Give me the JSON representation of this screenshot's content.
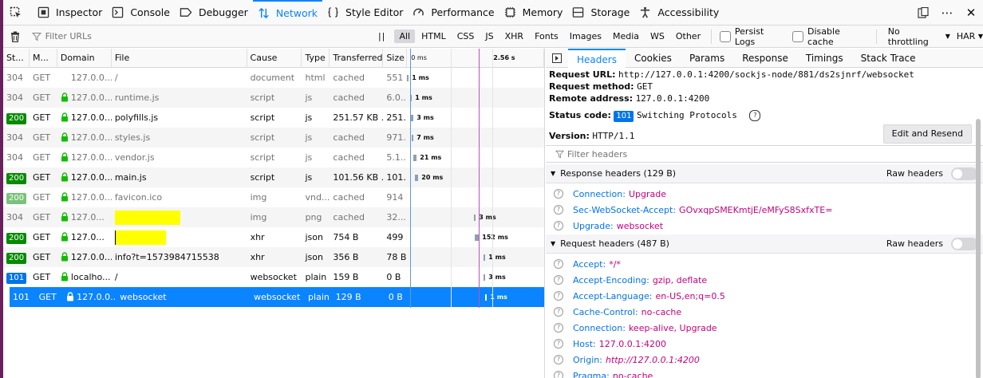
{
  "toolbar": {
    "tabs": [
      {
        "label": "Inspector",
        "icon": "inspector-icon"
      },
      {
        "label": "Console",
        "icon": "console-icon"
      },
      {
        "label": "Debugger",
        "icon": "debugger-icon"
      },
      {
        "label": "Network",
        "icon": "network-icon",
        "selected": true
      },
      {
        "label": "Style Editor",
        "icon": "style-editor-icon"
      },
      {
        "label": "Performance",
        "icon": "performance-icon"
      },
      {
        "label": "Memory",
        "icon": "memory-icon"
      },
      {
        "label": "Storage",
        "icon": "storage-icon"
      },
      {
        "label": "Accessibility",
        "icon": "accessibility-icon"
      }
    ],
    "more": "⋯",
    "close": "✕"
  },
  "filterbar": {
    "placeholder": "Filter URLs",
    "types": [
      "All",
      "HTML",
      "CSS",
      "JS",
      "XHR",
      "Fonts",
      "Images",
      "Media",
      "WS",
      "Other"
    ],
    "persist_logs": "Persist Logs",
    "disable_cache": "Disable cache",
    "throttling": "No throttling",
    "har": "HAR"
  },
  "columns": [
    "St...",
    "M...",
    "Domain",
    "File",
    "Cause",
    "Type",
    "Transferred",
    "Size"
  ],
  "waterfall_ticks": [
    "0 ms",
    "2.56 s"
  ],
  "requests": [
    {
      "status": "304",
      "method": "GET",
      "domain": "127.0.0...",
      "file": "/",
      "cause": "document",
      "type": "html",
      "transferred": "cached",
      "size": "551 B",
      "timing": "1 ms",
      "badge": "none",
      "secure": false
    },
    {
      "status": "304",
      "method": "GET",
      "domain": "127.0.0...",
      "file": "runtime.js",
      "cause": "script",
      "type": "js",
      "transferred": "cached",
      "size": "6.0...",
      "timing": "1 ms",
      "badge": "none",
      "secure": true
    },
    {
      "status": "200",
      "method": "GET",
      "domain": "127.0.0...",
      "file": "polyfills.js",
      "cause": "script",
      "type": "js",
      "transferred": "251.57 KB ...",
      "size": "251...",
      "timing": "3 ms",
      "badge": "200",
      "secure": true
    },
    {
      "status": "304",
      "method": "GET",
      "domain": "127.0.0...",
      "file": "styles.js",
      "cause": "script",
      "type": "js",
      "transferred": "cached",
      "size": "971...",
      "timing": "7 ms",
      "badge": "none",
      "secure": true
    },
    {
      "status": "304",
      "method": "GET",
      "domain": "127.0.0...",
      "file": "vendor.js",
      "cause": "script",
      "type": "js",
      "transferred": "cached",
      "size": "5.1...",
      "timing": "21 ms",
      "badge": "none",
      "secure": true
    },
    {
      "status": "200",
      "method": "GET",
      "domain": "127.0.0...",
      "file": "main.js",
      "cause": "script",
      "type": "js",
      "transferred": "101.56 KB ...",
      "size": "101...",
      "timing": "20 ms",
      "badge": "200",
      "secure": true
    },
    {
      "status": "200",
      "method": "GET",
      "domain": "127.0.0...",
      "file": "favicon.ico",
      "cause": "img",
      "type": "vnd...",
      "transferred": "cached",
      "size": "914 B",
      "timing": "",
      "badge": "200dim",
      "secure": true
    },
    {
      "status": "304",
      "method": "GET",
      "domain": "127.0...",
      "file": "",
      "cause": "img",
      "type": "png",
      "transferred": "cached",
      "size": "32....",
      "timing": "3 ms",
      "badge": "none",
      "secure": true
    },
    {
      "status": "200",
      "method": "GET",
      "domain": "127.0...",
      "file": "",
      "cause": "xhr",
      "type": "json",
      "transferred": "754 B",
      "size": "499 B",
      "timing": "152 ms",
      "badge": "200",
      "secure": true
    },
    {
      "status": "200",
      "method": "GET",
      "domain": "127.0.0...",
      "file": "info?t=1573984715538",
      "cause": "xhr",
      "type": "json",
      "transferred": "356 B",
      "size": "78 B",
      "timing": "1 ms",
      "badge": "200",
      "secure": true
    },
    {
      "status": "101",
      "method": "GET",
      "domain": "localho...",
      "file": "/",
      "cause": "websocket",
      "type": "plain",
      "transferred": "159 B",
      "size": "0 B",
      "timing": "3 ms",
      "badge": "101",
      "secure": true
    },
    {
      "status": "101",
      "method": "GET",
      "domain": "127.0.0...",
      "file": "websocket",
      "cause": "websocket",
      "type": "plain",
      "transferred": "129 B",
      "size": "0 B",
      "timing": "1 ms",
      "badge": "101sel",
      "secure": true
    }
  ],
  "panel": {
    "tabs": [
      "Headers",
      "Cookies",
      "Params",
      "Response",
      "Timings",
      "Stack Trace"
    ],
    "request_url_label": "Request URL:",
    "request_url": "http://127.0.0.1:4200/sockjs-node/881/ds2sjnrf/websocket",
    "request_method_label": "Request method:",
    "request_method": "GET",
    "remote_address_label": "Remote address:",
    "remote_address": "127.0.0.1:4200",
    "status_code_label": "Status code:",
    "status_code": "101",
    "status_text": "Switching Protocols",
    "version_label": "Version:",
    "version": "HTTP/1.1",
    "edit_resend": "Edit and Resend",
    "filter_headers": "Filter headers",
    "response_headers_title": "Response headers (129 B)",
    "request_headers_title": "Request headers (487 B)",
    "raw_headers": "Raw headers",
    "response_headers": [
      {
        "name": "Connection:",
        "value": "Upgrade"
      },
      {
        "name": "Sec-WebSocket-Accept:",
        "value": "GOvxqpSMEKmtjE/eMFyS8SxfxTE="
      },
      {
        "name": "Upgrade:",
        "value": "websocket"
      }
    ],
    "request_headers": [
      {
        "name": "Accept:",
        "value": "*/*"
      },
      {
        "name": "Accept-Encoding:",
        "value": "gzip, deflate"
      },
      {
        "name": "Accept-Language:",
        "value": "en-US,en;q=0.5"
      },
      {
        "name": "Cache-Control:",
        "value": "no-cache"
      },
      {
        "name": "Connection:",
        "value": "keep-alive, Upgrade"
      },
      {
        "name": "Host:",
        "value": "127.0.0.1:4200"
      },
      {
        "name": "Origin:",
        "value": "http://127.0.0.1:4200"
      },
      {
        "name": "Pragma:",
        "value": "no-cache"
      }
    ]
  }
}
